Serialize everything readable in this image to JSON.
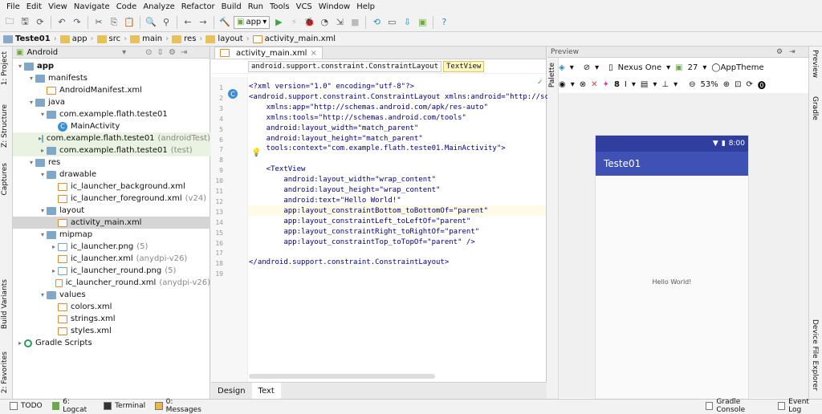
{
  "menu": [
    "File",
    "Edit",
    "View",
    "Navigate",
    "Code",
    "Analyze",
    "Refactor",
    "Build",
    "Run",
    "Tools",
    "VCS",
    "Window",
    "Help"
  ],
  "toolbar": {
    "run_config": "app"
  },
  "breadcrumb": [
    "Teste01",
    "app",
    "src",
    "main",
    "res",
    "layout",
    "activity_main.xml"
  ],
  "left_stripe": {
    "project": "1: Project",
    "structure": "Z: Structure",
    "captures": "Captures",
    "build_variants": "Build Variants",
    "favorites": "2: Favorites"
  },
  "project_panel": {
    "view": "Android"
  },
  "tree": [
    {
      "label": "app",
      "indent": 0,
      "arrow": "▾",
      "icon": "fold",
      "bold": true
    },
    {
      "label": "manifests",
      "indent": 1,
      "arrow": "▾",
      "icon": "fold"
    },
    {
      "label": "AndroidManifest.xml",
      "indent": 2,
      "arrow": "",
      "icon": "xml"
    },
    {
      "label": "java",
      "indent": 1,
      "arrow": "▾",
      "icon": "fold"
    },
    {
      "label": "com.example.flath.teste01",
      "indent": 2,
      "arrow": "▾",
      "icon": "fold"
    },
    {
      "label": "MainActivity",
      "indent": 3,
      "arrow": "",
      "icon": "cls"
    },
    {
      "label": "com.example.flath.teste01",
      "suffix": "(androidTest)",
      "indent": 2,
      "arrow": "▸",
      "icon": "fold",
      "hl": true
    },
    {
      "label": "com.example.flath.teste01",
      "suffix": "(test)",
      "indent": 2,
      "arrow": "▸",
      "icon": "fold",
      "hl": true
    },
    {
      "label": "res",
      "indent": 1,
      "arrow": "▾",
      "icon": "fold"
    },
    {
      "label": "drawable",
      "indent": 2,
      "arrow": "▾",
      "icon": "fold"
    },
    {
      "label": "ic_launcher_background.xml",
      "indent": 3,
      "arrow": "",
      "icon": "xml"
    },
    {
      "label": "ic_launcher_foreground.xml",
      "suffix": "(v24)",
      "indent": 3,
      "arrow": "",
      "icon": "xml"
    },
    {
      "label": "layout",
      "indent": 2,
      "arrow": "▾",
      "icon": "fold"
    },
    {
      "label": "activity_main.xml",
      "indent": 3,
      "arrow": "",
      "icon": "xml",
      "sel": true
    },
    {
      "label": "mipmap",
      "indent": 2,
      "arrow": "▾",
      "icon": "fold"
    },
    {
      "label": "ic_launcher.png",
      "suffix": "(5)",
      "indent": 3,
      "arrow": "▸",
      "icon": "png"
    },
    {
      "label": "ic_launcher.xml",
      "suffix": "(anydpi-v26)",
      "indent": 3,
      "arrow": "",
      "icon": "xml"
    },
    {
      "label": "ic_launcher_round.png",
      "suffix": "(5)",
      "indent": 3,
      "arrow": "▸",
      "icon": "png"
    },
    {
      "label": "ic_launcher_round.xml",
      "suffix": "(anydpi-v26)",
      "indent": 3,
      "arrow": "",
      "icon": "xml"
    },
    {
      "label": "values",
      "indent": 2,
      "arrow": "▾",
      "icon": "fold"
    },
    {
      "label": "colors.xml",
      "indent": 3,
      "arrow": "",
      "icon": "xml"
    },
    {
      "label": "strings.xml",
      "indent": 3,
      "arrow": "",
      "icon": "xml"
    },
    {
      "label": "styles.xml",
      "indent": 3,
      "arrow": "",
      "icon": "xml"
    },
    {
      "label": "Gradle Scripts",
      "indent": 0,
      "arrow": "▸",
      "icon": "gradle"
    }
  ],
  "editor": {
    "tab": "activity_main.xml",
    "crumbs": [
      "android.support.constraint.ConstraintLayout",
      "TextView"
    ],
    "lines": [
      {
        "n": "1",
        "t": "<?xml version=\"1.0\" encoding=\"utf-8\"?>"
      },
      {
        "n": "2",
        "t": "<android.support.constraint.ConstraintLayout xmlns:android=\"http://sche"
      },
      {
        "n": "3",
        "t": "    xmlns:app=\"http://schemas.android.com/apk/res-auto\""
      },
      {
        "n": "4",
        "t": "    xmlns:tools=\"http://schemas.android.com/tools\""
      },
      {
        "n": "5",
        "t": "    android:layout_width=\"match_parent\""
      },
      {
        "n": "6",
        "t": "    android:layout_height=\"match_parent\""
      },
      {
        "n": "7",
        "t": "    tools:context=\"com.example.flath.teste01.MainActivity\">"
      },
      {
        "n": "8",
        "t": ""
      },
      {
        "n": "9",
        "t": "    <TextView"
      },
      {
        "n": "10",
        "t": "        android:layout_width=\"wrap_content\""
      },
      {
        "n": "11",
        "t": "        android:layout_height=\"wrap_content\""
      },
      {
        "n": "12",
        "t": "        android:text=\"Hello World!\""
      },
      {
        "n": "13",
        "t": "        app:layout_constraintBottom_toBottomOf=\"parent\""
      },
      {
        "n": "14",
        "t": "        app:layout_constraintLeft_toLeftOf=\"parent\""
      },
      {
        "n": "15",
        "t": "        app:layout_constraintRight_toRightOf=\"parent\""
      },
      {
        "n": "16",
        "t": "        app:layout_constraintTop_toTopOf=\"parent\" />"
      },
      {
        "n": "17",
        "t": ""
      },
      {
        "n": "18",
        "t": "</android.support.constraint.ConstraintLayout>"
      },
      {
        "n": "19",
        "t": ""
      }
    ],
    "bottom_tabs": [
      "Design",
      "Text"
    ]
  },
  "preview": {
    "title": "Preview",
    "palette": "Palette",
    "device": "Nexus One",
    "api": "27",
    "theme": "AppTheme",
    "zoom": "53%",
    "density": "8",
    "phone": {
      "time": "8:00",
      "app_title": "Teste01",
      "hello": "Hello World!"
    }
  },
  "right_stripe": {
    "preview": "Preview",
    "gradle": "Gradle",
    "device_explorer": "Device File Explorer"
  },
  "statusbar": {
    "todo": "TODO",
    "logcat": "6: Logcat",
    "terminal": "Terminal",
    "messages": "0: Messages",
    "gradle_console": "Gradle Console",
    "event_log": "Event Log"
  }
}
